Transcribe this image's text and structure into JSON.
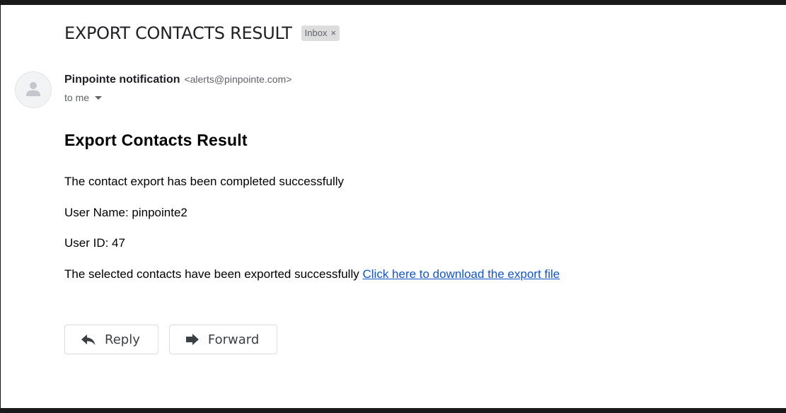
{
  "email": {
    "subject": "EXPORT CONTACTS RESULT",
    "label": "Inbox",
    "label_remove": "×",
    "sender_name": "Pinpointe notification",
    "sender_email": "<alerts@pinpointe.com>",
    "recipient": "to me"
  },
  "content": {
    "heading": "Export Contacts Result",
    "line1": "The contact export has been completed successfully",
    "line2": "User Name: pinpointe2",
    "line3": "User ID: 47",
    "line4": "The selected contacts have been exported successfully",
    "download_link": "Click here to download the export file"
  },
  "actions": {
    "reply_label": "Reply",
    "forward_label": "Forward"
  },
  "icons": {
    "avatar": "person-icon",
    "reply": "reply-icon",
    "forward": "forward-icon",
    "caret": "chevron-down-icon"
  }
}
